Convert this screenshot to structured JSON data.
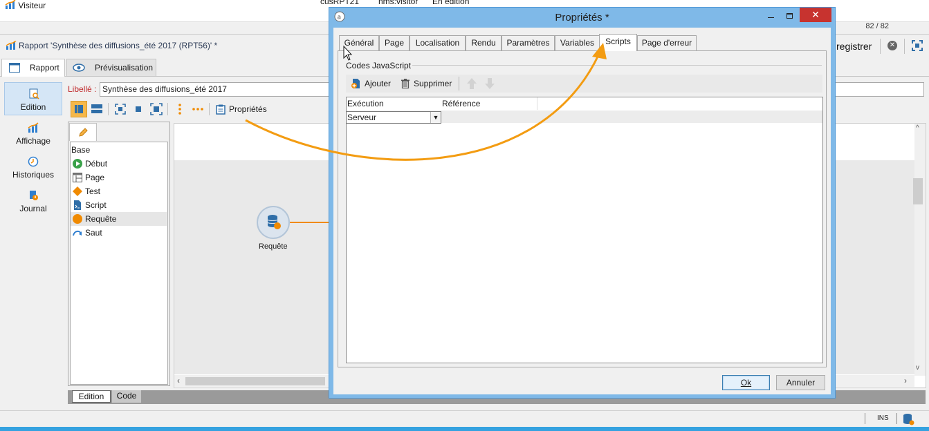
{
  "background": {
    "list_row": {
      "name": "Visiteur",
      "code": "cusRPT21",
      "schema": "nms:visitor",
      "status": "En édition"
    },
    "counter": "82 / 82",
    "report_title": "Rapport 'Synthèse des diffusions_été 2017 (RPT56)' *",
    "save_label": "registrer",
    "tabs": [
      {
        "label": "Rapport"
      },
      {
        "label": "Prévisualisation"
      }
    ],
    "nav": [
      {
        "label": "Edition",
        "icon": "edit-page-icon"
      },
      {
        "label": "Affichage",
        "icon": "chart-icon"
      },
      {
        "label": "Historiques",
        "icon": "clock-icon"
      },
      {
        "label": "Journal",
        "icon": "journal-icon"
      }
    ],
    "libelle_label": "Libellé :",
    "libelle_value": "Synthèse des diffusions_été 2017",
    "properties_button": "Propriétés",
    "palette": {
      "title": "Base",
      "items": [
        {
          "label": "Début",
          "icon": "start-icon"
        },
        {
          "label": "Page",
          "icon": "page-icon"
        },
        {
          "label": "Test",
          "icon": "test-icon"
        },
        {
          "label": "Script",
          "icon": "script-icon"
        },
        {
          "label": "Requête",
          "icon": "query-icon"
        },
        {
          "label": "Saut",
          "icon": "jump-icon"
        }
      ]
    },
    "node_label": "Requête",
    "bottom_tabs": [
      {
        "label": "Edition"
      },
      {
        "label": "Code"
      }
    ],
    "status_ins": "INS"
  },
  "dialog": {
    "title": "Propriétés *",
    "tabs": [
      {
        "label": "Général"
      },
      {
        "label": "Page"
      },
      {
        "label": "Localisation"
      },
      {
        "label": "Rendu"
      },
      {
        "label": "Paramètres"
      },
      {
        "label": "Variables"
      },
      {
        "label": "Scripts"
      },
      {
        "label": "Page d'erreur"
      }
    ],
    "active_tab": "Scripts",
    "group_label": "Codes JavaScript",
    "toolbar": {
      "add": "Ajouter",
      "remove": "Supprimer"
    },
    "columns": [
      "Exécution",
      "Référence"
    ],
    "row": {
      "execution": "Serveur"
    },
    "ok": "Ok",
    "cancel": "Annuler"
  },
  "colors": {
    "accent": "#f39c12",
    "title_bar": "#7fb9e8",
    "close": "#c7332f",
    "libelle": "#c0282a"
  }
}
